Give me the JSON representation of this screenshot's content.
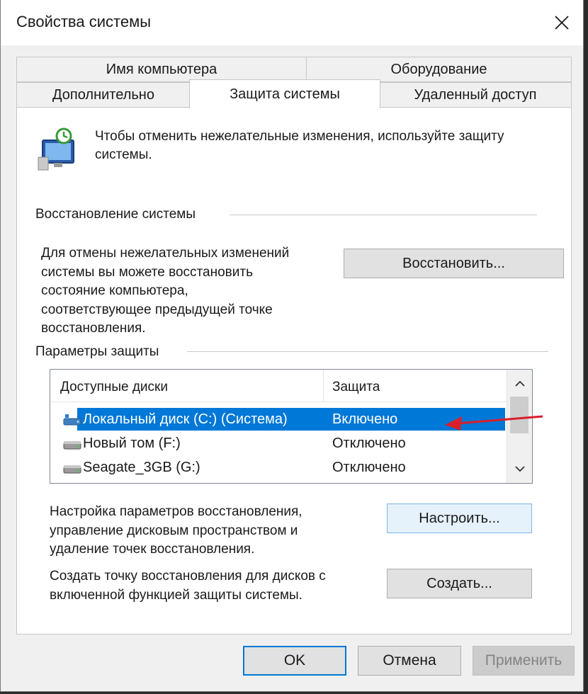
{
  "window": {
    "title": "Свойства системы"
  },
  "tabs": {
    "row_back": [
      {
        "label": "Имя компьютера"
      },
      {
        "label": "Оборудование"
      }
    ],
    "row_front": [
      {
        "label": "Дополнительно"
      },
      {
        "label": "Защита системы"
      },
      {
        "label": "Удаленный доступ"
      }
    ],
    "active": "Защита системы"
  },
  "intro_text": "Чтобы отменить нежелательные изменения, используйте защиту системы.",
  "restore": {
    "group_title": "Восстановление системы",
    "description": [
      "Для отмены нежелательных изменений",
      "системы вы можете восстановить",
      "состояние компьютера,",
      "соответствующее предыдущей точке",
      "восстановления."
    ],
    "button_label": "Восстановить..."
  },
  "protection": {
    "group_title": "Параметры защиты",
    "columns": [
      "Доступные диски",
      "Защита"
    ],
    "drives": [
      {
        "name": "Локальный диск (C:) (Система)",
        "status": "Включено",
        "icon": "system-drive-icon",
        "selected": true
      },
      {
        "name": "Новый том (F:)",
        "status": "Отключено",
        "icon": "drive-icon",
        "selected": false
      },
      {
        "name": "Seagate_3GB (G:)",
        "status": "Отключено",
        "icon": "drive-icon",
        "selected": false
      }
    ],
    "configure_text": [
      "Настройка параметров восстановления,",
      "управление дисковым пространством и",
      "удаление точек восстановления."
    ],
    "configure_button": "Настроить...",
    "create_text": [
      "Создать точку восстановления для дисков с",
      "включенной функцией защиты системы."
    ],
    "create_button": "Создать..."
  },
  "footer": {
    "ok": "OK",
    "cancel": "Отмена",
    "apply": "Применить"
  },
  "colors": {
    "selection": "#0078d7",
    "annotation_arrow": "#d9202a"
  }
}
